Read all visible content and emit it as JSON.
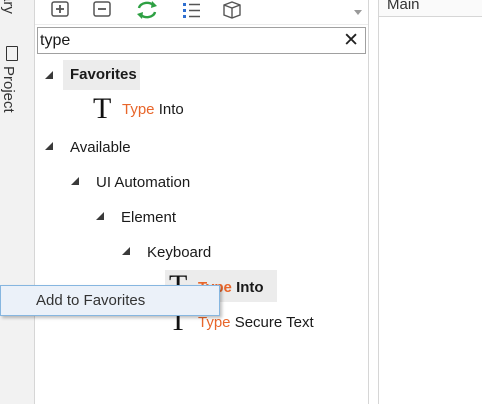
{
  "rail": {
    "tab_library": "rary",
    "tab_project": "Project"
  },
  "toolbar": {
    "buttons": [
      {
        "icon": "expand-all-icon"
      },
      {
        "icon": "collapse-all-icon"
      },
      {
        "icon": "refresh-icon",
        "color": "#2ea043"
      },
      {
        "icon": "filter-list-icon"
      },
      {
        "icon": "package-icon"
      }
    ]
  },
  "search": {
    "value": "type",
    "clear_glyph": "✕"
  },
  "tree": {
    "favorites": {
      "label": "Favorites"
    },
    "fav_type_into": {
      "match": "Type",
      "rest": " Into",
      "icon_glyph": "T"
    },
    "available": {
      "label": "Available"
    },
    "ui_automation": {
      "label": "UI Automation"
    },
    "element": {
      "label": "Element"
    },
    "keyboard": {
      "label": "Keyboard"
    },
    "type_into": {
      "match": "Type",
      "rest": " Into",
      "icon_glyph": "T"
    },
    "type_secure_text": {
      "match": "Type",
      "rest": " Secure Text",
      "icon_glyph": "T"
    },
    "highlight_color": "#e8662b"
  },
  "context_menu": {
    "items": [
      {
        "label": "Add to Favorites"
      }
    ]
  },
  "designer": {
    "title": "Main"
  }
}
